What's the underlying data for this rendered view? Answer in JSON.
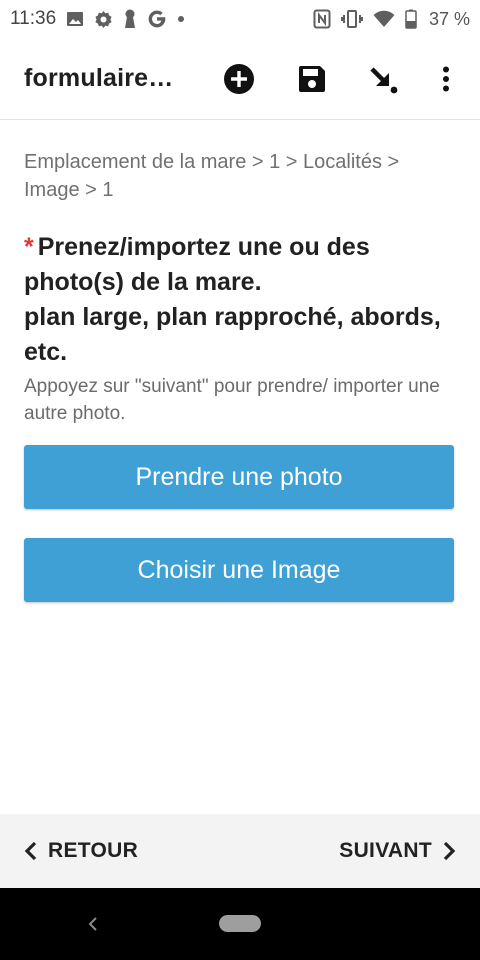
{
  "status_bar": {
    "time": "11:36",
    "battery": "37 %"
  },
  "app_bar": {
    "title": "formulaire…"
  },
  "breadcrumb": "Emplacement de la mare > 1 > Localités > Image > 1",
  "question": {
    "required_mark": "*",
    "line1": "Prenez/importez une ou des photo(s) de la mare.",
    "line2": "plan large, plan rapproché, abords, etc.",
    "hint": "Appoyez sur \"suivant\" pour prendre/ importer une autre photo."
  },
  "buttons": {
    "take_photo": "Prendre une photo",
    "choose_image": "Choisir une Image"
  },
  "bottom_nav": {
    "back": "RETOUR",
    "next": "SUIVANT"
  },
  "colors": {
    "accent": "#3ea0d5",
    "required": "#e53935",
    "bottom_bar": "#f3f3f3"
  }
}
